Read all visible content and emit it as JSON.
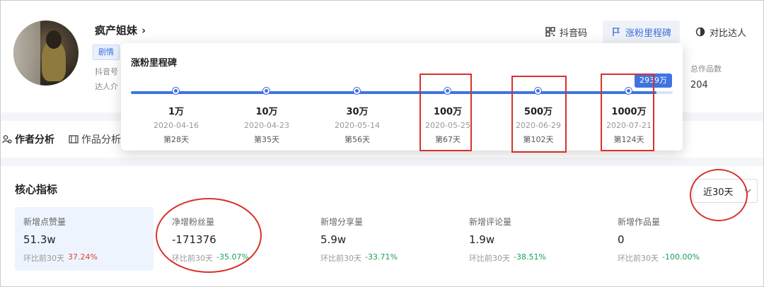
{
  "profile": {
    "name": "疯产姐妹",
    "tag": "剧情",
    "meta_1": "抖音号",
    "meta_2": "达人介",
    "stat_label": "总作品数",
    "stat_value": "204"
  },
  "actions": {
    "qrcode": "抖音码",
    "milestone": "涨粉里程碑",
    "compare": "对比达人"
  },
  "tabs": [
    {
      "label": "作者分析"
    },
    {
      "label": "作品分析"
    }
  ],
  "milestones": {
    "title": "涨粉里程碑",
    "current": "2939万",
    "progress": 0.97,
    "items": [
      {
        "value": "1万",
        "date": "2020-04-16",
        "day": "第28天"
      },
      {
        "value": "10万",
        "date": "2020-04-23",
        "day": "第35天"
      },
      {
        "value": "30万",
        "date": "2020-05-14",
        "day": "第56天"
      },
      {
        "value": "100万",
        "date": "2020-05-25",
        "day": "第67天"
      },
      {
        "value": "500万",
        "date": "2020-06-29",
        "day": "第102天"
      },
      {
        "value": "1000万",
        "date": "2020-07-21",
        "day": "第124天"
      }
    ]
  },
  "core": {
    "title": "核心指标",
    "period": "近30天",
    "metrics": [
      {
        "label": "新增点赞量",
        "value": "51.3w",
        "cmp": "环比前30天",
        "change": "37.24%",
        "dir": "up"
      },
      {
        "label": "净增粉丝量",
        "value": "-171376",
        "cmp": "环比前30天",
        "change": "-35.07%",
        "dir": "down"
      },
      {
        "label": "新增分享量",
        "value": "5.9w",
        "cmp": "环比前30天",
        "change": "-33.71%",
        "dir": "down"
      },
      {
        "label": "新增评论量",
        "value": "1.9w",
        "cmp": "环比前30天",
        "change": "-38.51%",
        "dir": "down"
      },
      {
        "label": "新增作品量",
        "value": "0",
        "cmp": "环比前30天",
        "change": "-100.00%",
        "dir": "down"
      }
    ]
  },
  "colors": {
    "accent": "#3f74e0",
    "up": "#e0423b",
    "down": "#18a058",
    "annotation": "#d8322b"
  }
}
